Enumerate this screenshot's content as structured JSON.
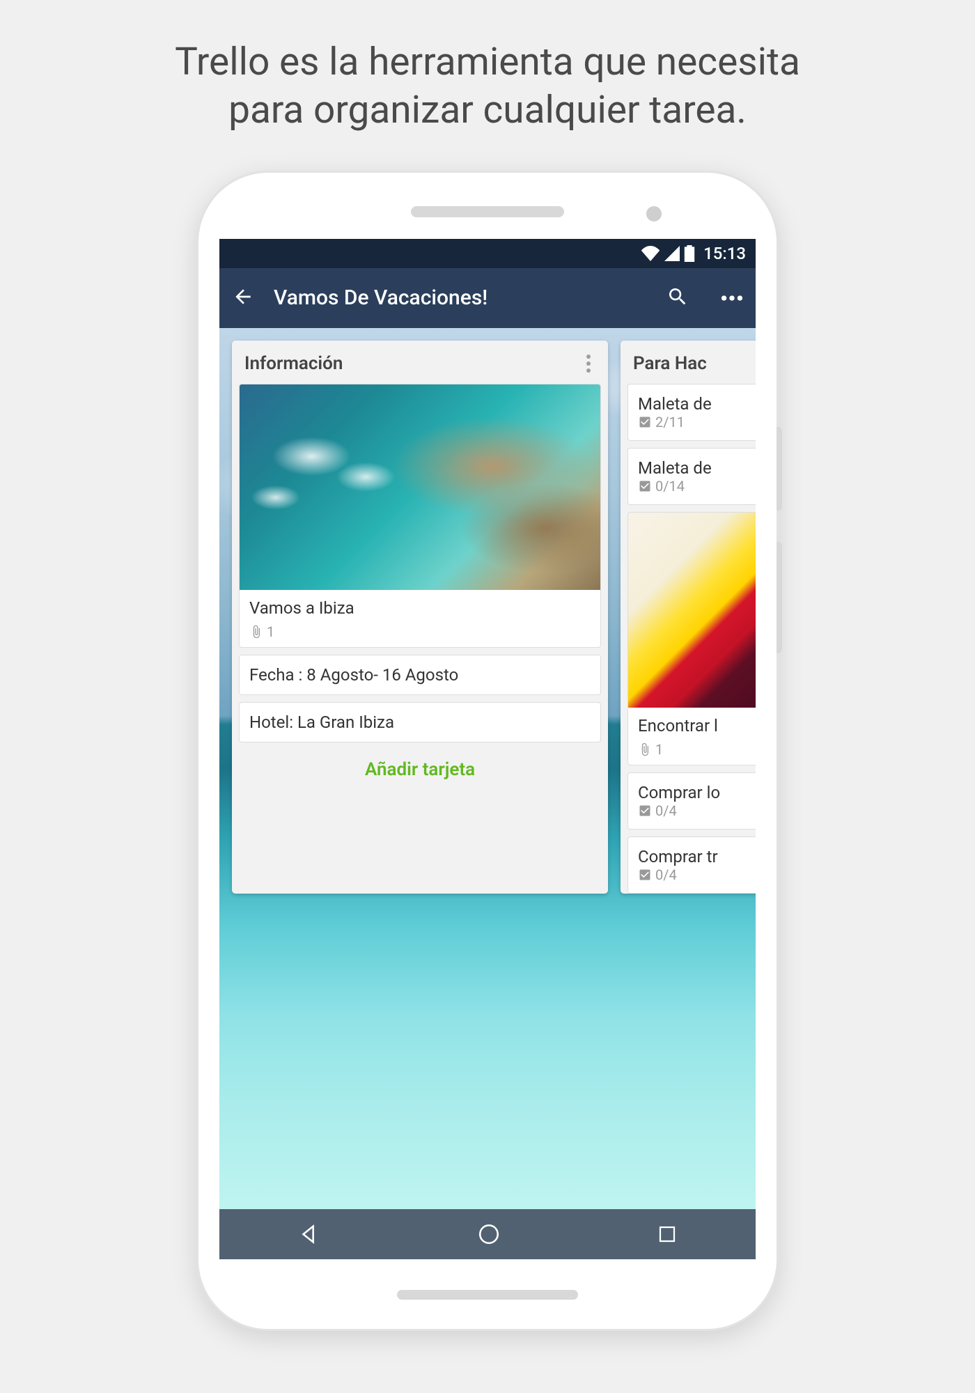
{
  "headline_line1": "Trello es la herramienta que necesita",
  "headline_line2": "para organizar cualquier tarea.",
  "status": {
    "time": "15:13"
  },
  "appbar": {
    "title": "Vamos De Vacaciones!"
  },
  "lists": [
    {
      "title": "Información",
      "add_label": "Añadir tarjeta",
      "cards": [
        {
          "title": "Vamos a Ibiza",
          "attachment_count": "1",
          "has_cover": true
        },
        {
          "title": "Fecha : 8 Agosto- 16 Agosto"
        },
        {
          "title": "Hotel: La Gran Ibiza"
        }
      ]
    },
    {
      "title": "Para Hac",
      "cards": [
        {
          "title": "Maleta de",
          "checklist": "2/11"
        },
        {
          "title": "Maleta de",
          "checklist": "0/14"
        },
        {
          "title": "Encontrar l",
          "attachment_count": "1",
          "has_passport_cover": true
        },
        {
          "title": "Comprar lo",
          "checklist": "0/4"
        },
        {
          "title": "Comprar tr",
          "checklist": "0/4"
        }
      ]
    }
  ]
}
